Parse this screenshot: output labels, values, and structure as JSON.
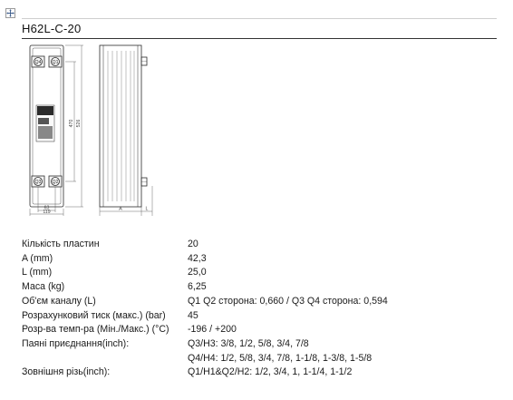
{
  "title": "H62L-C-20",
  "drawing": {
    "port_labels": [
      "Q4",
      "Q1",
      "Q3",
      "Q2"
    ],
    "dim_width_inner": "63",
    "dim_width_outer": "119",
    "dim_height_inner": "470",
    "dim_height_outer": "526",
    "dim_a": "A",
    "dim_l": "L"
  },
  "specs": [
    {
      "label": "Кількість пластин",
      "values": [
        "20"
      ]
    },
    {
      "label": "A (mm)",
      "values": [
        "42,3"
      ]
    },
    {
      "label": "L (mm)",
      "values": [
        "25,0"
      ]
    },
    {
      "label": "Маса (kg)",
      "values": [
        "6,25"
      ]
    },
    {
      "label": "Об'єм каналу (L)",
      "values": [
        "Q1 Q2 сторона: 0,660 / Q3 Q4 сторона: 0,594"
      ]
    },
    {
      "label": "Розрахунковий тиск (макс.) (bar)",
      "values": [
        "45"
      ]
    },
    {
      "label": "Розр-ва темп-ра (Мін./Макс.) (°C)",
      "values": [
        "-196 / +200"
      ]
    },
    {
      "label": "Паяні приєднання(inch):",
      "values": [
        "Q3/H3: 3/8, 1/2, 5/8, 3/4, 7/8",
        "Q4/H4: 1/2, 5/8, 3/4, 7/8, 1-1/8, 1-3/8, 1-5/8"
      ]
    },
    {
      "label": "Зовнішня різь(inch):",
      "values": [
        "Q1/H1&Q2/H2: 1/2, 3/4, 1, 1-1/4, 1-1/2"
      ]
    }
  ]
}
